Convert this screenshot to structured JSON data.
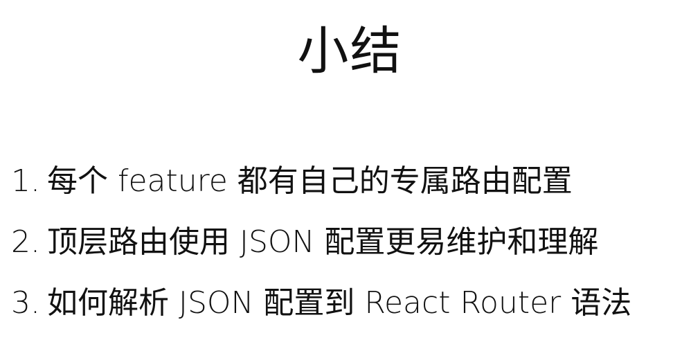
{
  "slide": {
    "title": "小结",
    "points": [
      {
        "number": "1.",
        "text": "每个 feature 都有自己的专属路由配置"
      },
      {
        "number": "2.",
        "text": "顶层路由使用 JSON 配置更易维护和理解"
      },
      {
        "number": "3.",
        "text": "如何解析 JSON 配置到 React Router 语法"
      }
    ]
  }
}
